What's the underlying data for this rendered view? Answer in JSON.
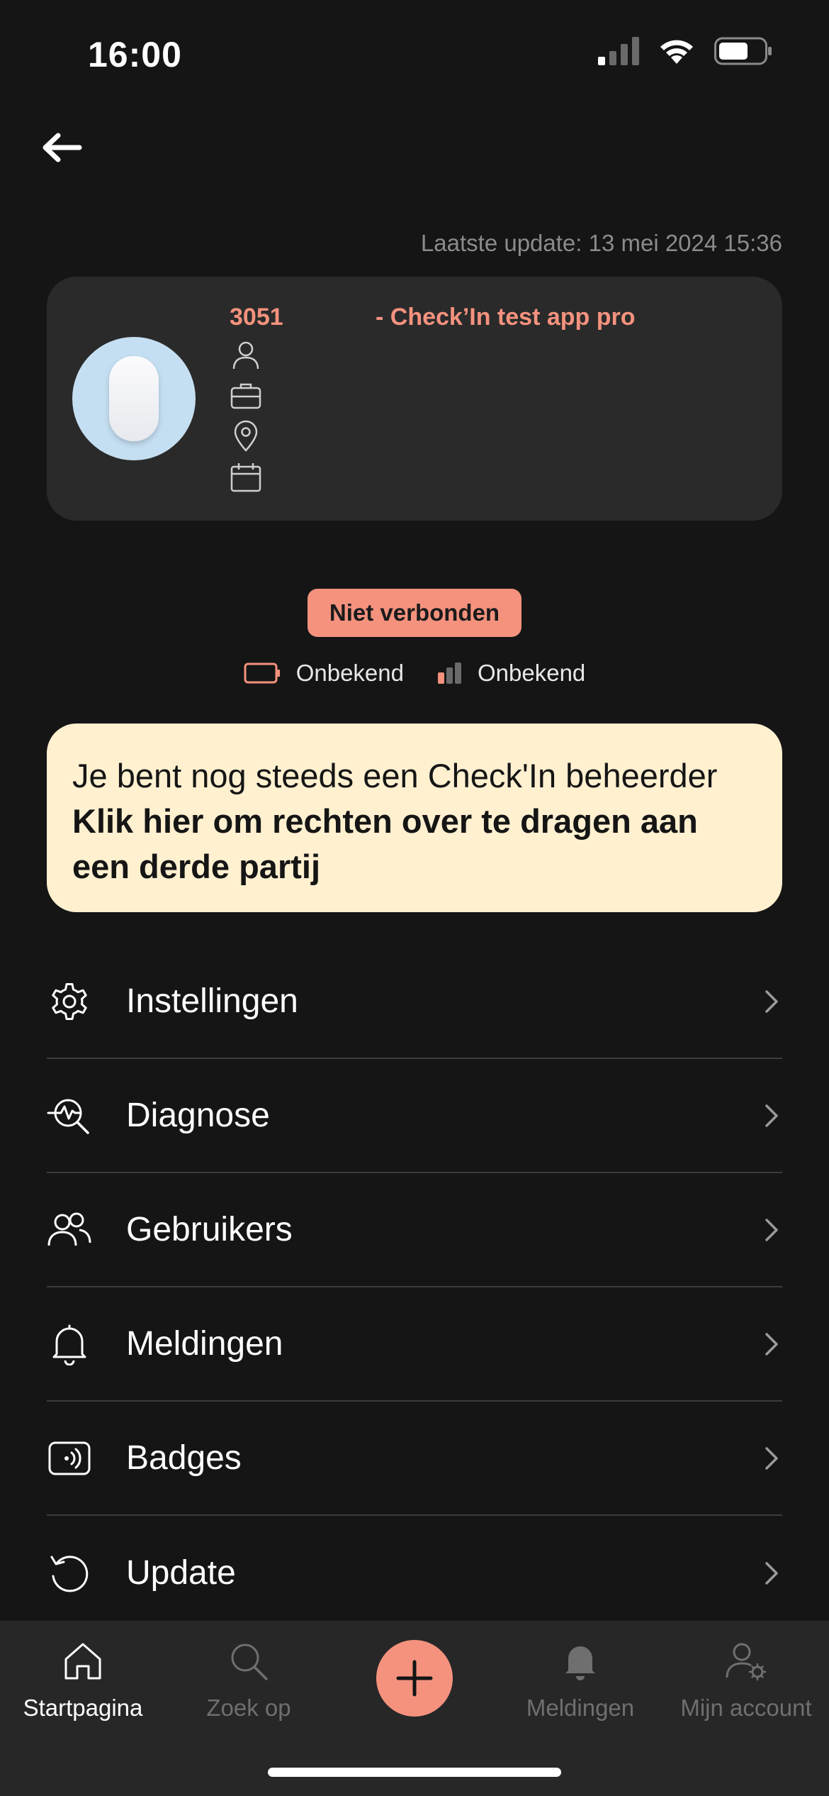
{
  "status_bar": {
    "time": "16:00"
  },
  "header": {
    "last_update": "Laatste update: 13 mei 2024 15:36"
  },
  "device": {
    "id": "3051",
    "name": "- Check’In test app pro"
  },
  "connection": {
    "badge": "Niet verbonden",
    "battery": "Onbekend",
    "signal": "Onbekend"
  },
  "banner": {
    "line1": "Je bent nog steeds een Check'In beheerder",
    "line2": "Klik hier om rechten over te dragen aan een derde partij"
  },
  "menu": {
    "items": [
      {
        "label": "Instellingen",
        "icon": "gear-icon"
      },
      {
        "label": "Diagnose",
        "icon": "diagnose-icon"
      },
      {
        "label": "Gebruikers",
        "icon": "users-icon"
      },
      {
        "label": "Meldingen",
        "icon": "bell-icon"
      },
      {
        "label": "Badges",
        "icon": "badge-icon"
      },
      {
        "label": "Update",
        "icon": "update-icon"
      }
    ]
  },
  "tabs": {
    "home": "Startpagina",
    "search": "Zoek op",
    "notifications": "Meldingen",
    "account": "Mijn account"
  },
  "colors": {
    "accent": "#f4927e",
    "background": "#151515",
    "card": "#2a2a2a",
    "banner": "#fff0d0"
  }
}
